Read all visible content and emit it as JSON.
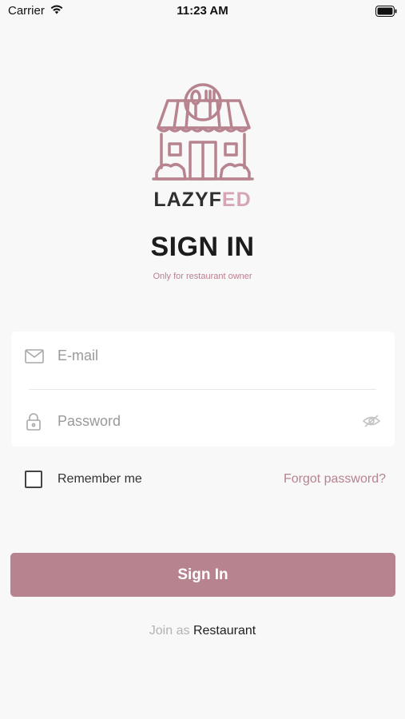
{
  "status_bar": {
    "carrier": "Carrier",
    "time": "11:23 AM",
    "wifi_icon": "wifi-icon",
    "battery_icon": "battery-icon"
  },
  "brand": {
    "logo_icon": "storefront-icon",
    "name_part1": "LAZYF",
    "name_part2": "ED",
    "color_dark": "#2f2f2f",
    "color_accent": "#d6a5b3"
  },
  "header": {
    "title": "SIGN IN",
    "subtitle": "Only for restaurant owner"
  },
  "form": {
    "email_placeholder": "E-mail",
    "email_value": "",
    "email_icon": "mail-icon",
    "password_placeholder": "Password",
    "password_value": "",
    "password_icon": "lock-icon",
    "visibility_icon": "eye-off-icon"
  },
  "options": {
    "remember_label": "Remember me",
    "remember_checked": false,
    "forgot_label": "Forgot password?"
  },
  "actions": {
    "signin_label": "Sign In",
    "join_prefix": "Join as",
    "join_link": "Restaurant"
  },
  "colors": {
    "accent": "#b7838f",
    "background": "#f8f8f8"
  }
}
